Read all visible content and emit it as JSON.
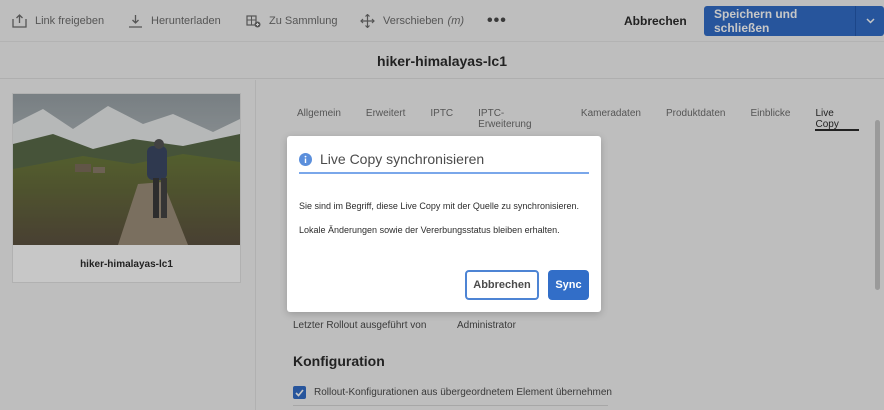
{
  "toolbar": {
    "share_label": "Link freigeben",
    "download_label": "Herunterladen",
    "collection_label": "Zu Sammlung",
    "move_label": "Verschieben",
    "move_shortcut": "(m)",
    "more_label": "•••",
    "cancel_label": "Abbrechen",
    "save_label": "Speichern und schließen"
  },
  "page": {
    "title": "hiker-himalayas-lc1"
  },
  "card": {
    "title": "hiker-himalayas-lc1"
  },
  "tabs": [
    {
      "label": "Allgemein"
    },
    {
      "label": "Erweitert"
    },
    {
      "label": "IPTC"
    },
    {
      "label": "IPTC-Erweiterung"
    },
    {
      "label": "Kameradaten"
    },
    {
      "label": "Produktdaten"
    },
    {
      "label": "Einblicke"
    },
    {
      "label": "Live Copy"
    }
  ],
  "live_copy": {
    "last_rollout_label": "Letzter Rollout ausgeführt von",
    "last_rollout_value": "Administrator",
    "config_title": "Konfiguration",
    "inherit_label": "Rollout-Konfigurationen aus übergeordnetem Element übernehmen"
  },
  "dialog": {
    "title": "Live Copy synchronisieren",
    "line1": "Sie sind im Begriff, diese Live Copy mit der Quelle zu synchronisieren.",
    "line2": "Lokale Änderungen sowie der Vererbungsstatus bleiben erhalten.",
    "cancel_label": "Abbrechen",
    "sync_label": "Sync"
  },
  "colors": {
    "accent": "#326ec8",
    "info": "#326ec8"
  }
}
